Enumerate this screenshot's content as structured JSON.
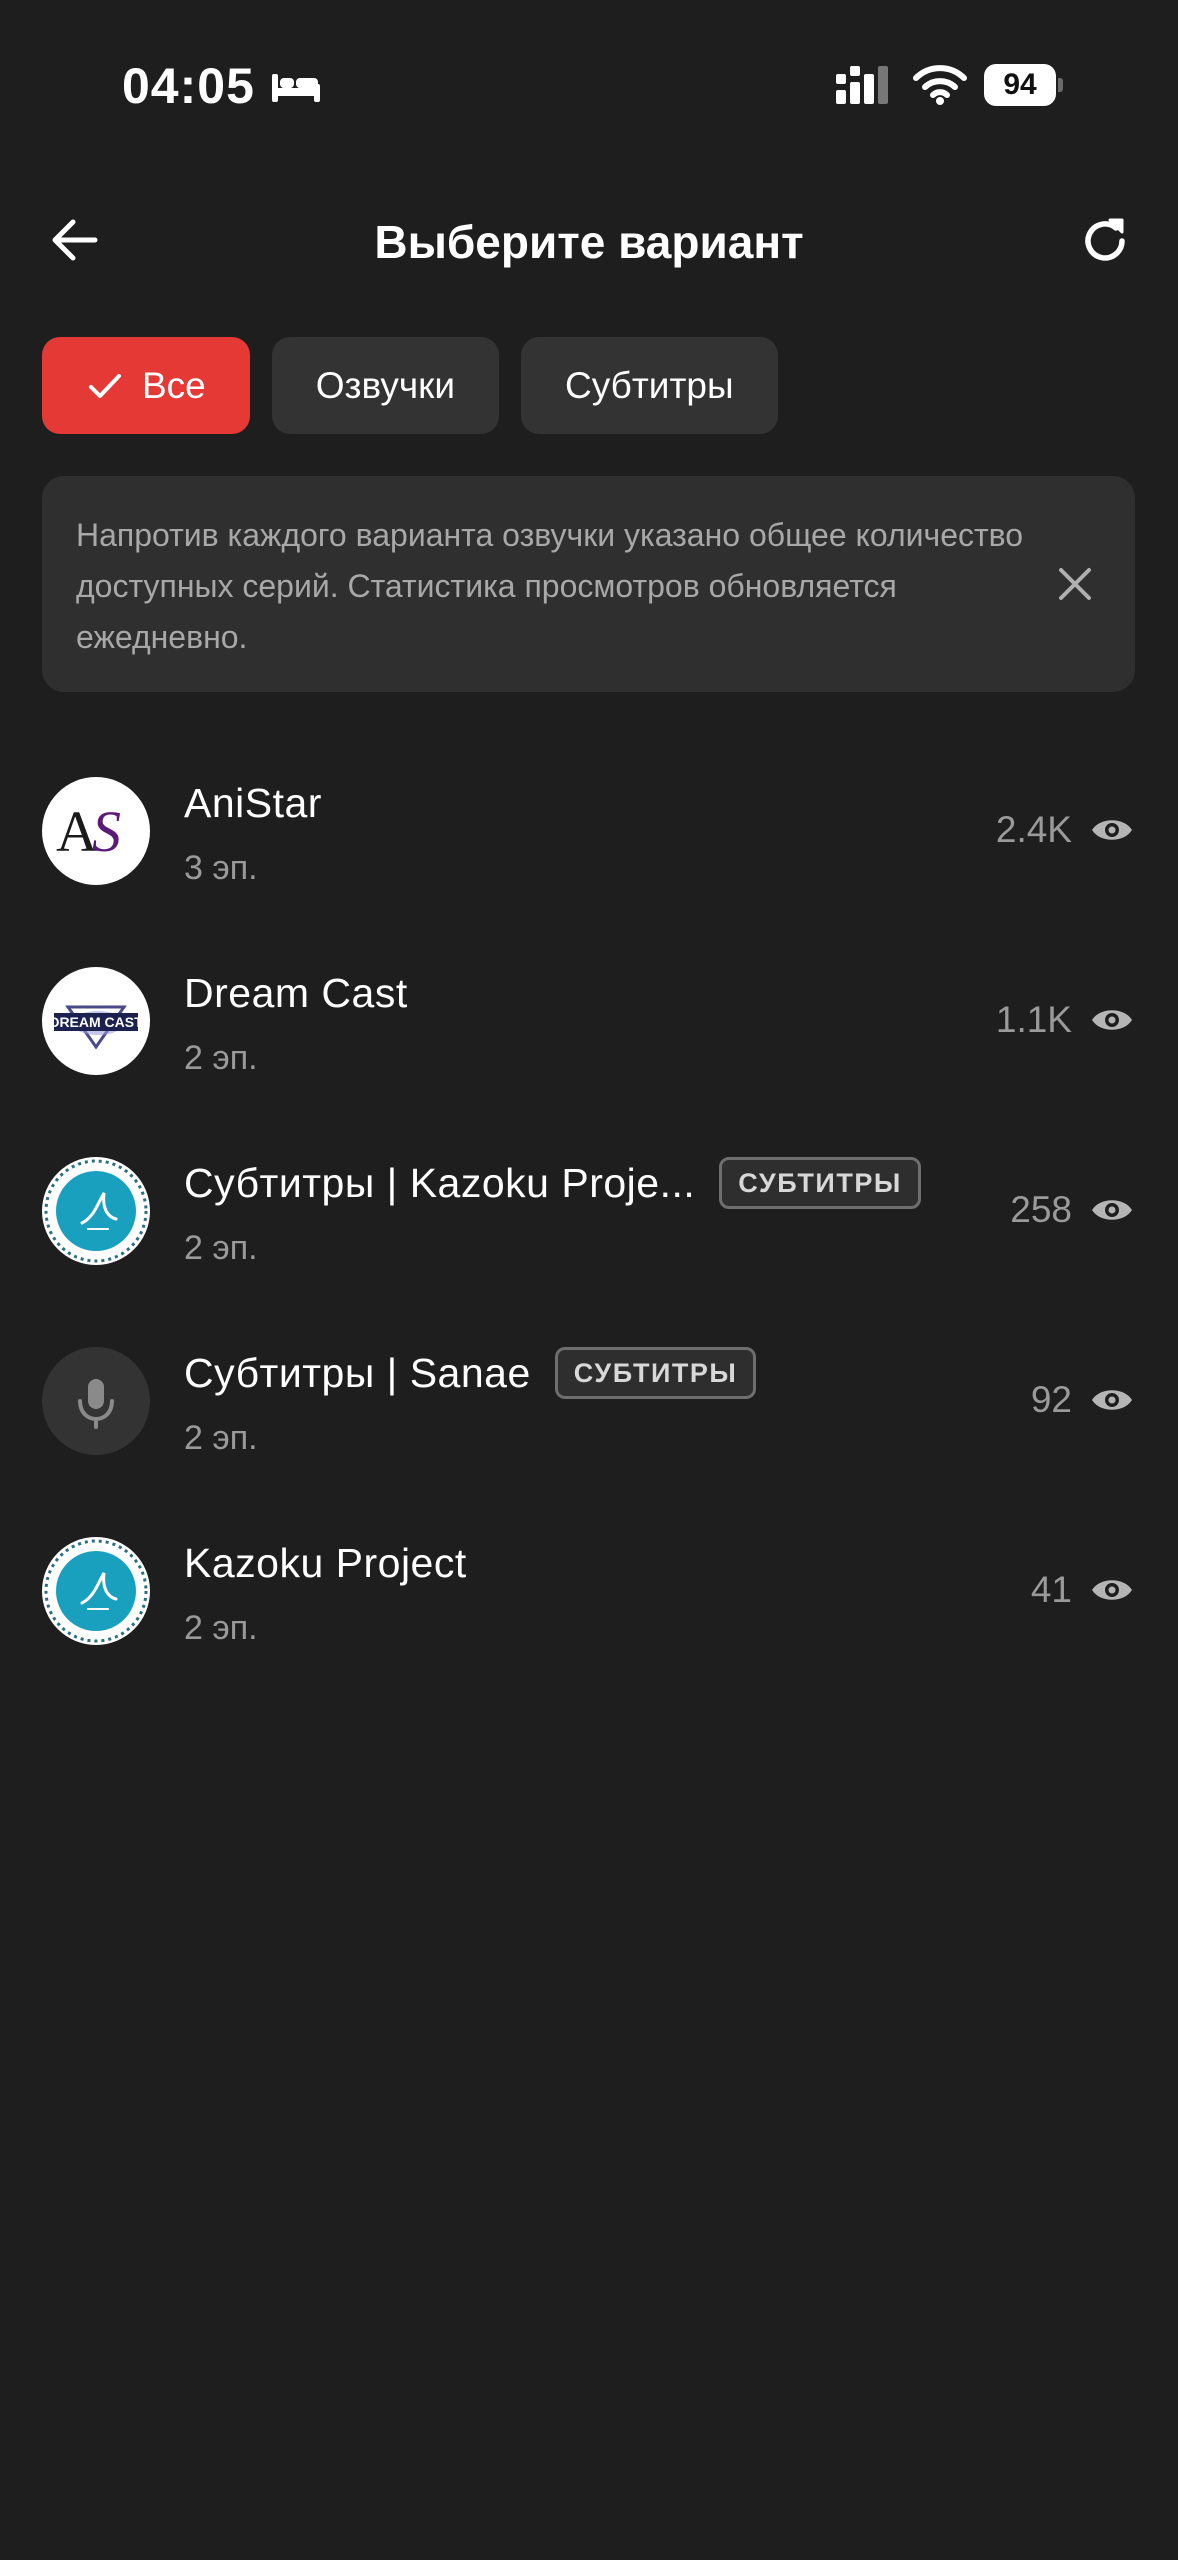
{
  "status_bar": {
    "time": "04:05",
    "battery": "94",
    "icons": [
      "bed-icon",
      "cellular-signal-icon",
      "wifi-icon",
      "battery-icon"
    ]
  },
  "header": {
    "title": "Выберите вариант",
    "back_icon": "arrow-left-icon",
    "refresh_icon": "refresh-icon"
  },
  "filters": {
    "items": [
      {
        "label": "Все",
        "active": true
      },
      {
        "label": "Озвучки",
        "active": false
      },
      {
        "label": "Субтитры",
        "active": false
      }
    ],
    "active_color": "#e53935"
  },
  "info": {
    "text": "Напротив каждого варианта озвучки указано общее количество доступных серий. Статистика просмотров обновляется ежедневно.",
    "close_icon": "close-icon"
  },
  "list": {
    "items": [
      {
        "title": "AniStar",
        "episodes": "3 эп.",
        "views": "2.4K",
        "badge": "",
        "avatar": "anistar-logo"
      },
      {
        "title": "Dream Cast",
        "episodes": "2 эп.",
        "views": "1.1K",
        "badge": "",
        "avatar": "dream-cast-logo"
      },
      {
        "title": "Субтитры | Kazoku Proje...",
        "episodes": "2 эп.",
        "views": "258",
        "badge": "СУБТИТРЫ",
        "avatar": "kazoku-logo"
      },
      {
        "title": "Субтитры | Sanae",
        "episodes": "2 эп.",
        "views": "92",
        "badge": "СУБТИТРЫ",
        "avatar": "microphone-icon"
      },
      {
        "title": "Kazoku Project",
        "episodes": "2 эп.",
        "views": "41",
        "badge": "",
        "avatar": "kazoku-logo"
      }
    ]
  }
}
